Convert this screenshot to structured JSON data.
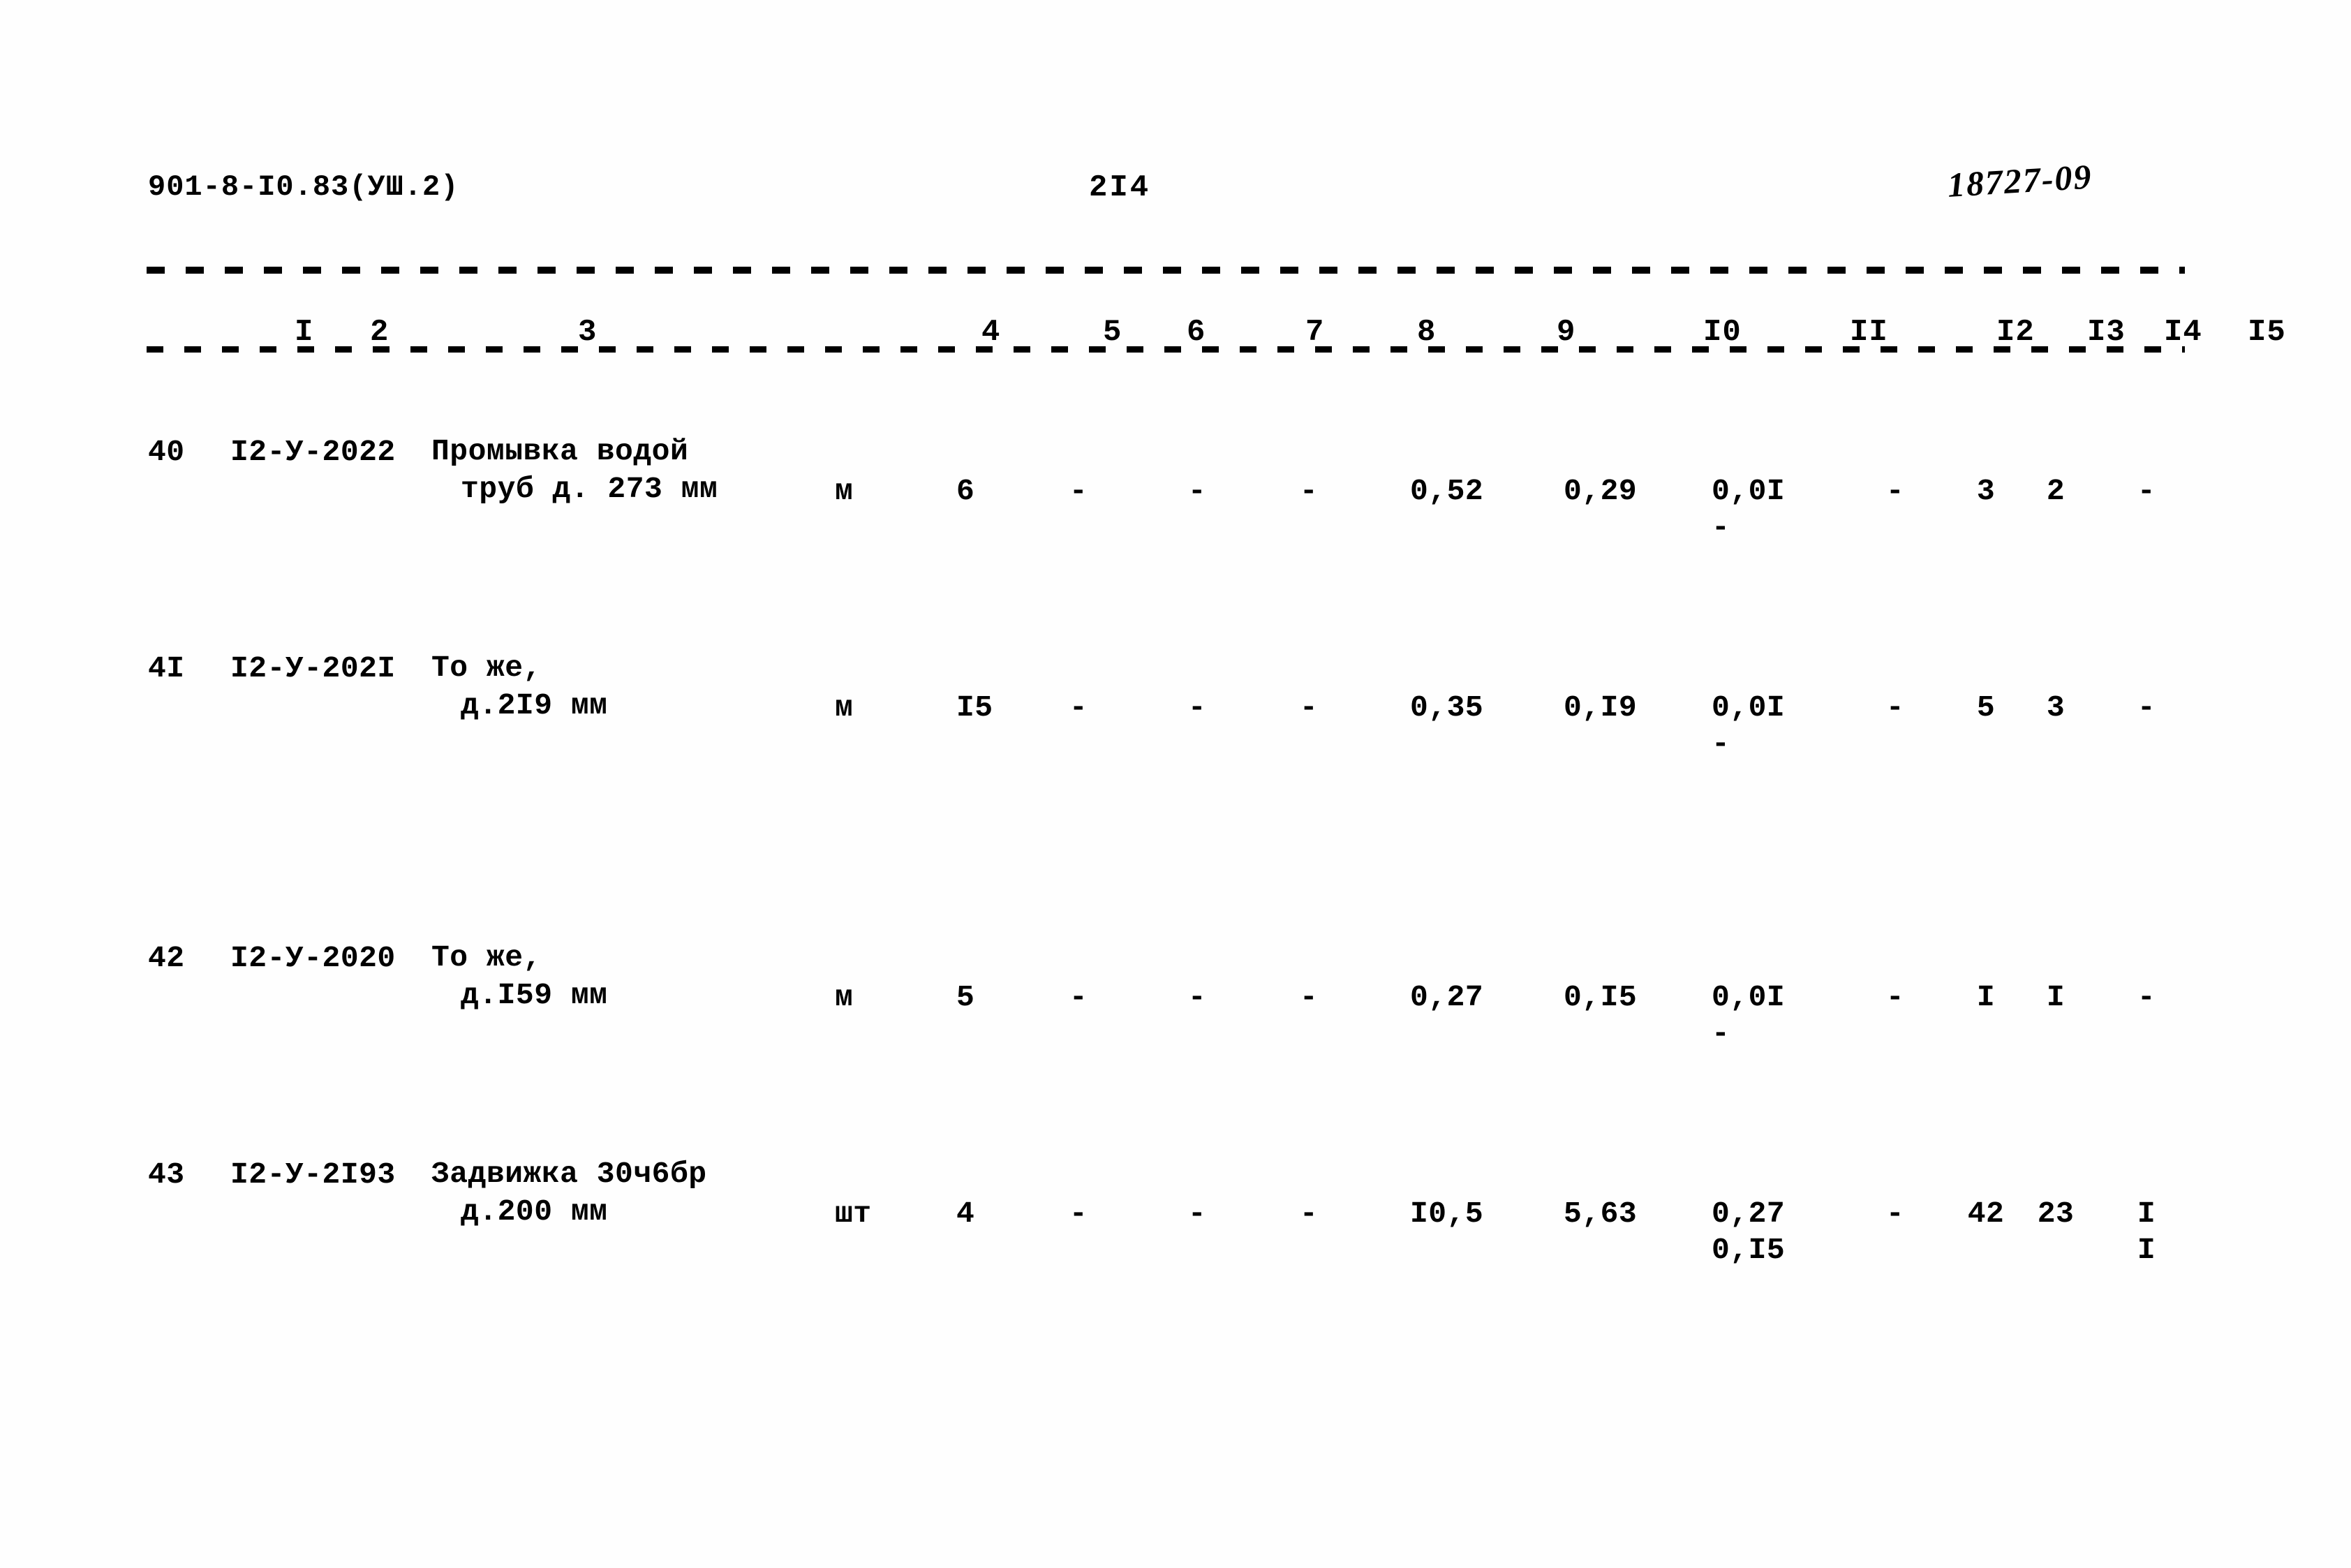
{
  "header": {
    "doc_code": "901-8-I0.83(УШ.2)",
    "page_number": "2I4",
    "stamp_number": "18727-09"
  },
  "column_numbers": [
    "I",
    "2",
    "3",
    "4",
    "5",
    "6",
    "7",
    "8",
    "9",
    "I0",
    "II",
    "I2",
    "I3",
    "I4",
    "I5"
  ],
  "rows": [
    {
      "num": "40",
      "code": "I2-У-2022",
      "name_line1": "Промывка водой",
      "name_line2": "труб д. 273 мм",
      "unit": "м",
      "qty": "6",
      "c6": "-",
      "c7": "-",
      "c8": "-",
      "c9": "0,52",
      "c10": "0,29",
      "c11": "0,0I",
      "c11_sub": "-",
      "c12": "-",
      "c13": "3",
      "c14": "2",
      "c15": "-",
      "c15_sub": ""
    },
    {
      "num": "4I",
      "code": "I2-У-202I",
      "name_line1": "То же,",
      "name_line2": "д.2I9 мм",
      "unit": "м",
      "qty": "I5",
      "c6": "-",
      "c7": "-",
      "c8": "-",
      "c9": "0,35",
      "c10": "0,I9",
      "c11": "0,0I",
      "c11_sub": "-",
      "c12": "-",
      "c13": "5",
      "c14": "3",
      "c15": "-",
      "c15_sub": ""
    },
    {
      "num": "42",
      "code": "I2-У-2020",
      "name_line1": "То же,",
      "name_line2": "д.I59 мм",
      "unit": "м",
      "qty": "5",
      "c6": "-",
      "c7": "-",
      "c8": "-",
      "c9": "0,27",
      "c10": "0,I5",
      "c11": "0,0I",
      "c11_sub": "-",
      "c12": "-",
      "c13": "I",
      "c14": "I",
      "c15": "-",
      "c15_sub": ""
    },
    {
      "num": "43",
      "code": "I2-У-2I93",
      "name_line1": "Задвижка 30ч6бр",
      "name_line2": "д.200 мм",
      "unit": "шт",
      "qty": "4",
      "c6": "-",
      "c7": "-",
      "c8": "-",
      "c9": "I0,5",
      "c10": "5,63",
      "c11": "0,27",
      "c11_sub": "0,I5",
      "c12": "-",
      "c13": "42",
      "c14": "23",
      "c15": "I",
      "c15_sub": "I"
    }
  ]
}
